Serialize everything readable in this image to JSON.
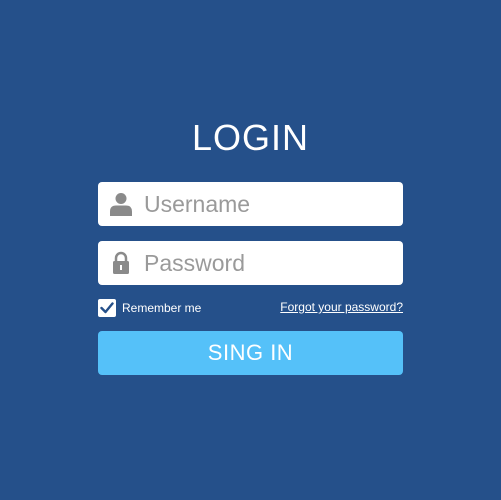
{
  "login": {
    "title": "LOGIN",
    "username_placeholder": "Username",
    "password_placeholder": "Password",
    "remember_label": "Remember me",
    "remember_checked": true,
    "forgot_link": "Forgot your password?",
    "submit_label": "SING IN",
    "icons": {
      "username": "user-icon",
      "password": "lock-icon",
      "checkbox": "checkmark-icon"
    }
  },
  "colors": {
    "background": "#25508a",
    "field_background": "#ffffff",
    "placeholder": "#9a9a9a",
    "icon": "#8a8a8a",
    "button": "#55c1f9",
    "text": "#ffffff"
  }
}
